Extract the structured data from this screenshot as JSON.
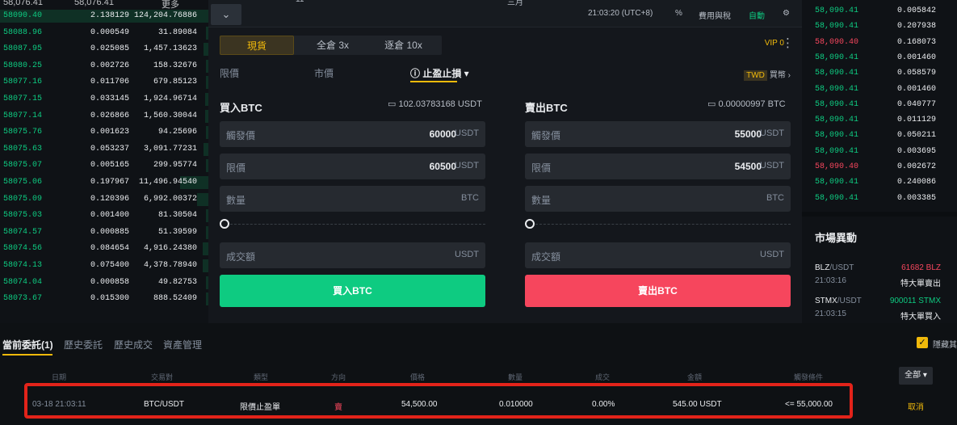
{
  "ob_left": {
    "header": [
      "58,076.41",
      "58,076.41",
      "更多"
    ],
    "rows": [
      {
        "price": "58090.40",
        "amount": "2.138129",
        "total": "124,204.76886",
        "bar": 0.96
      },
      {
        "price": "58088.96",
        "amount": "0.000549",
        "total": "31.89084",
        "bar": 0.02
      },
      {
        "price": "58087.95",
        "amount": "0.025085",
        "total": "1,457.13623",
        "bar": 0.04
      },
      {
        "price": "58080.25",
        "amount": "0.002726",
        "total": "158.32676",
        "bar": 0.02
      },
      {
        "price": "58077.16",
        "amount": "0.011706",
        "total": "679.85123",
        "bar": 0.02
      },
      {
        "price": "58077.15",
        "amount": "0.033145",
        "total": "1,924.96714",
        "bar": 0.03
      },
      {
        "price": "58077.14",
        "amount": "0.026866",
        "total": "1,560.30044",
        "bar": 0.03
      },
      {
        "price": "58075.76",
        "amount": "0.001623",
        "total": "94.25696",
        "bar": 0.02
      },
      {
        "price": "58075.63",
        "amount": "0.053237",
        "total": "3,091.77231",
        "bar": 0.04
      },
      {
        "price": "58075.07",
        "amount": "0.005165",
        "total": "299.95774",
        "bar": 0.02
      },
      {
        "price": "58075.06",
        "amount": "0.197967",
        "total": "11,496.94540",
        "bar": 0.25
      },
      {
        "price": "58075.09",
        "amount": "0.120396",
        "total": "6,992.00372",
        "bar": 0.1
      },
      {
        "price": "58075.03",
        "amount": "0.001400",
        "total": "81.30504",
        "bar": 0.02
      },
      {
        "price": "58074.57",
        "amount": "0.000885",
        "total": "51.39599",
        "bar": 0.02
      },
      {
        "price": "58074.56",
        "amount": "0.084654",
        "total": "4,916.24380",
        "bar": 0.05
      },
      {
        "price": "58074.13",
        "amount": "0.075400",
        "total": "4,378.78940",
        "bar": 0.05
      },
      {
        "price": "58074.04",
        "amount": "0.000858",
        "total": "49.82753",
        "bar": 0.02
      },
      {
        "price": "58073.67",
        "amount": "0.015300",
        "total": "888.52409",
        "bar": 0.02
      }
    ]
  },
  "topbar": {
    "col1": "11",
    "col2": "三月",
    "time": "21:03:20 (UTC+8)",
    "pct": "%",
    "fees": "費用與稅",
    "auto": "自動",
    "gear": "⚙"
  },
  "mode_tabs": {
    "spot": "現貨",
    "cross": "全倉 3x",
    "isolated": "逐倉 10x"
  },
  "vip": "VIP 0",
  "order_types": {
    "limit": "限價",
    "market": "市價",
    "stop": "止盈止損 ▾"
  },
  "twd": {
    "badge": "TWD",
    "text": "買幣 ›"
  },
  "buy": {
    "title": "買入BTC",
    "avail": "▭ 102.03783168 USDT",
    "trigger_lbl": "觸發價",
    "trigger_val": "60000",
    "trigger_unit": "USDT",
    "limit_lbl": "限價",
    "limit_val": "60500",
    "limit_unit": "USDT",
    "qty_lbl": "數量",
    "qty_unit": "BTC",
    "total_lbl": "成交額",
    "total_unit": "USDT",
    "button": "買入BTC"
  },
  "sell": {
    "title": "賣出BTC",
    "avail": "▭ 0.00000997 BTC",
    "trigger_lbl": "觸發價",
    "trigger_val": "55000",
    "trigger_unit": "USDT",
    "limit_lbl": "限價",
    "limit_val": "54500",
    "limit_unit": "USDT",
    "qty_lbl": "數量",
    "qty_unit": "BTC",
    "total_lbl": "成交額",
    "total_unit": "USDT",
    "button": "賣出BTC"
  },
  "ob_right": [
    {
      "price": "58,090.41",
      "amount": "0.005842",
      "color": "#0ecb81"
    },
    {
      "price": "58,090.41",
      "amount": "0.207938",
      "color": "#0ecb81"
    },
    {
      "price": "58,090.40",
      "amount": "0.168073",
      "color": "#f6465d"
    },
    {
      "price": "58,090.41",
      "amount": "0.001460",
      "color": "#0ecb81"
    },
    {
      "price": "58,090.41",
      "amount": "0.058579",
      "color": "#0ecb81"
    },
    {
      "price": "58,090.41",
      "amount": "0.001460",
      "color": "#0ecb81"
    },
    {
      "price": "58,090.41",
      "amount": "0.040777",
      "color": "#0ecb81"
    },
    {
      "price": "58,090.41",
      "amount": "0.011129",
      "color": "#0ecb81"
    },
    {
      "price": "58,090.41",
      "amount": "0.050211",
      "color": "#0ecb81"
    },
    {
      "price": "58,090.41",
      "amount": "0.003695",
      "color": "#0ecb81"
    },
    {
      "price": "58,090.40",
      "amount": "0.002672",
      "color": "#f6465d"
    },
    {
      "price": "58,090.41",
      "amount": "0.240086",
      "color": "#0ecb81"
    },
    {
      "price": "58,090.41",
      "amount": "0.003385",
      "color": "#0ecb81"
    }
  ],
  "market": {
    "title": "市場異動",
    "items": [
      {
        "sym": "BLZ",
        "quote": "/USDT",
        "time": "21:03:16",
        "vol": "61682 BLZ",
        "vol_color": "#f6465d",
        "event": "特大單賣出"
      },
      {
        "sym": "STMX",
        "quote": "/USDT",
        "time": "21:03:15",
        "vol": "900011 STMX",
        "vol_color": "#0ecb81",
        "event": "特大單買入"
      }
    ]
  },
  "orders": {
    "tabs": [
      "當前委託(1)",
      "歷史委託",
      "歷史成交",
      "資產管理"
    ],
    "hide_label": "隱藏其",
    "all": "全部 ▾",
    "headers": [
      "日期",
      "交易對",
      "類型",
      "方向",
      "價格",
      "數量",
      "成交",
      "金額",
      "觸發條件"
    ],
    "row": {
      "date": "03-18 21:03:11",
      "pair": "BTC/USDT",
      "type": "限價止盈單",
      "side": "賣",
      "price": "54,500.00",
      "qty": "0.010000",
      "filled": "0.00%",
      "amount": "545.00 USDT",
      "trigger": "<= 55,000.00",
      "cancel": "取消"
    }
  },
  "colors": {
    "accent": "#f0b90b",
    "buy": "#0ecb81",
    "sell": "#f6465d",
    "highlight": "#e2231a"
  }
}
